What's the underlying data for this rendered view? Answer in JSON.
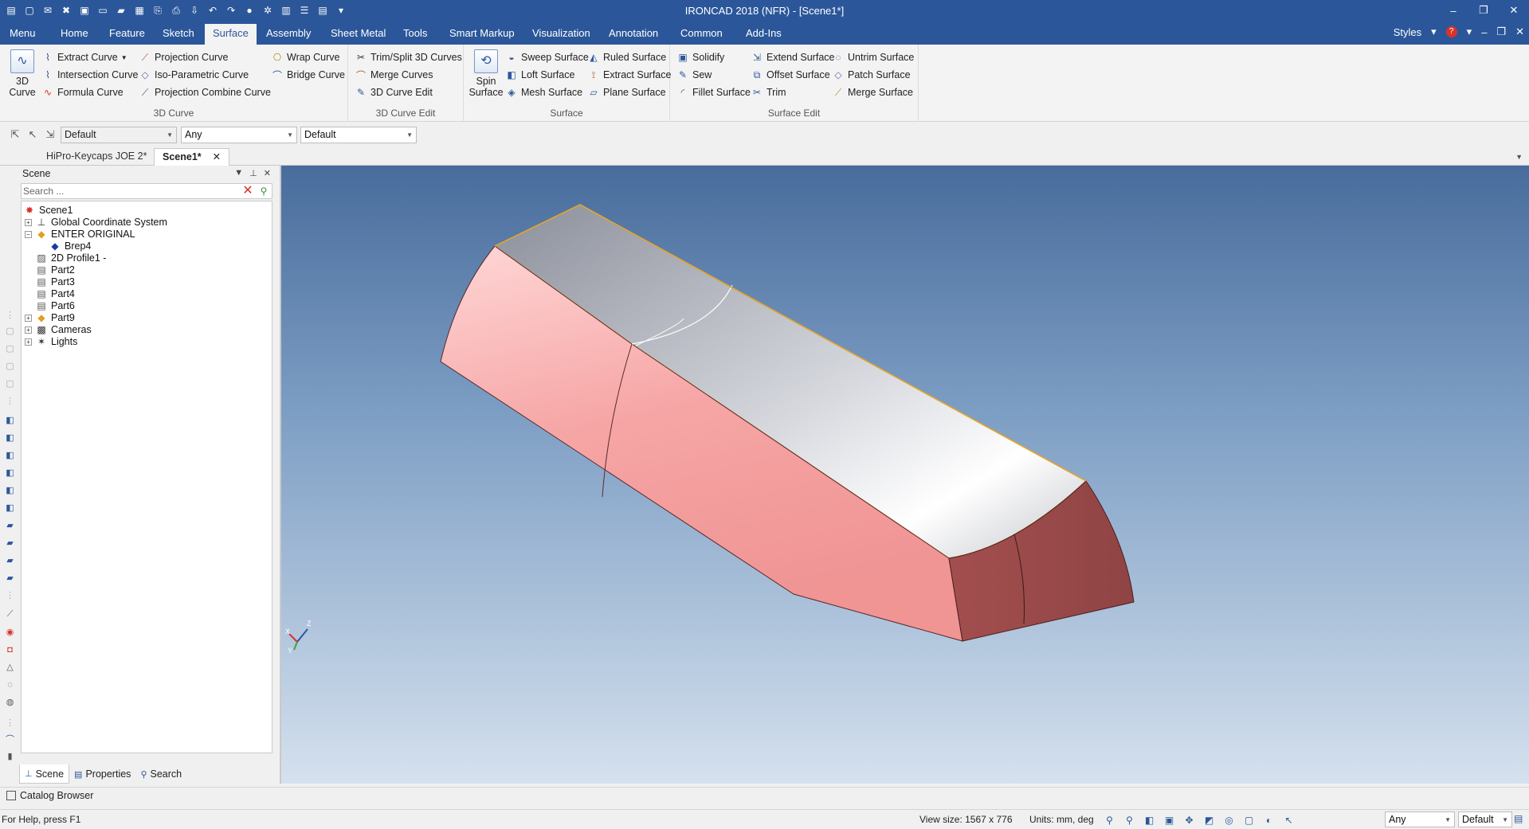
{
  "window": {
    "title": "IRONCAD 2018 (NFR) - [Scene1*]",
    "controls": [
      "minimize",
      "restore",
      "close"
    ]
  },
  "ribbon_tabs": [
    "Menu",
    "Home",
    "Feature",
    "Sketch",
    "Surface",
    "Assembly",
    "Sheet Metal",
    "Tools",
    "Smart Markup",
    "Visualization",
    "Annotation",
    "Common",
    "Add-Ins"
  ],
  "active_tab": "Surface",
  "styles_label": "Styles",
  "groups": {
    "curve3d": {
      "label": "3D Curve",
      "big_button": "3D Curve",
      "buttons": [
        "Extract Curve",
        "Intersection Curve",
        "Formula Curve",
        "Projection Curve",
        "Iso-Parametric Curve",
        "Projection Combine Curve",
        "Wrap Curve",
        "Bridge Curve"
      ]
    },
    "curve_edit": {
      "label": "3D Curve Edit",
      "buttons": [
        "Trim/Split 3D Curves",
        "Merge Curves",
        "3D Curve Edit"
      ]
    },
    "surface": {
      "label": "Surface",
      "big_button": "Spin Surface",
      "buttons": [
        "Sweep Surface",
        "Loft Surface",
        "Mesh Surface",
        "Ruled Surface",
        "Extract Surface",
        "Plane Surface"
      ]
    },
    "surface_edit": {
      "label": "Surface Edit",
      "buttons": [
        "Solidify",
        "Sew",
        "Fillet Surface",
        "Extend Surface",
        "Offset Surface",
        "Trim",
        "Untrim Surface",
        "Patch Surface",
        "Merge Surface"
      ]
    }
  },
  "filterbar": {
    "combo1": "Default",
    "combo2": "Any",
    "combo3": "Default"
  },
  "document_tabs": [
    "HiPro-Keycaps JOE 2*",
    "Scene1*"
  ],
  "scene_panel": {
    "title": "Scene",
    "search_placeholder": "Search ...",
    "tree": [
      {
        "label": "Scene1",
        "icon": "scene-icon"
      },
      {
        "label": "Global Coordinate System",
        "icon": "coordinate-system-icon"
      },
      {
        "label": "ENTER ORIGINAL",
        "icon": "assembly-icon"
      },
      {
        "label": "Brep4",
        "icon": "brep-icon"
      },
      {
        "label": "2D Profile1 -",
        "icon": "profile-icon"
      },
      {
        "label": "Part2",
        "icon": "part-icon"
      },
      {
        "label": "Part3",
        "icon": "part-icon"
      },
      {
        "label": "Part4",
        "icon": "part-icon"
      },
      {
        "label": "Part6",
        "icon": "part-icon"
      },
      {
        "label": "Part9",
        "icon": "assembly-icon"
      },
      {
        "label": "Cameras",
        "icon": "camera-icon"
      },
      {
        "label": "Lights",
        "icon": "light-icon"
      }
    ],
    "bottom_tabs": [
      "Scene",
      "Properties",
      "Search"
    ]
  },
  "catalog_label": "Catalog Browser",
  "status": {
    "help_text": "For Help, press F1",
    "view_size": "View size: 1567 x  776",
    "units": "Units: mm, deg",
    "combo_any": "Any",
    "combo_default": "Default"
  },
  "axis_labels": {
    "z": "Z",
    "x": "X",
    "y": "Y"
  },
  "colors": {
    "accent": "#2b579a",
    "model_side": "#f4a3a3",
    "model_top": "#c8cad2"
  }
}
